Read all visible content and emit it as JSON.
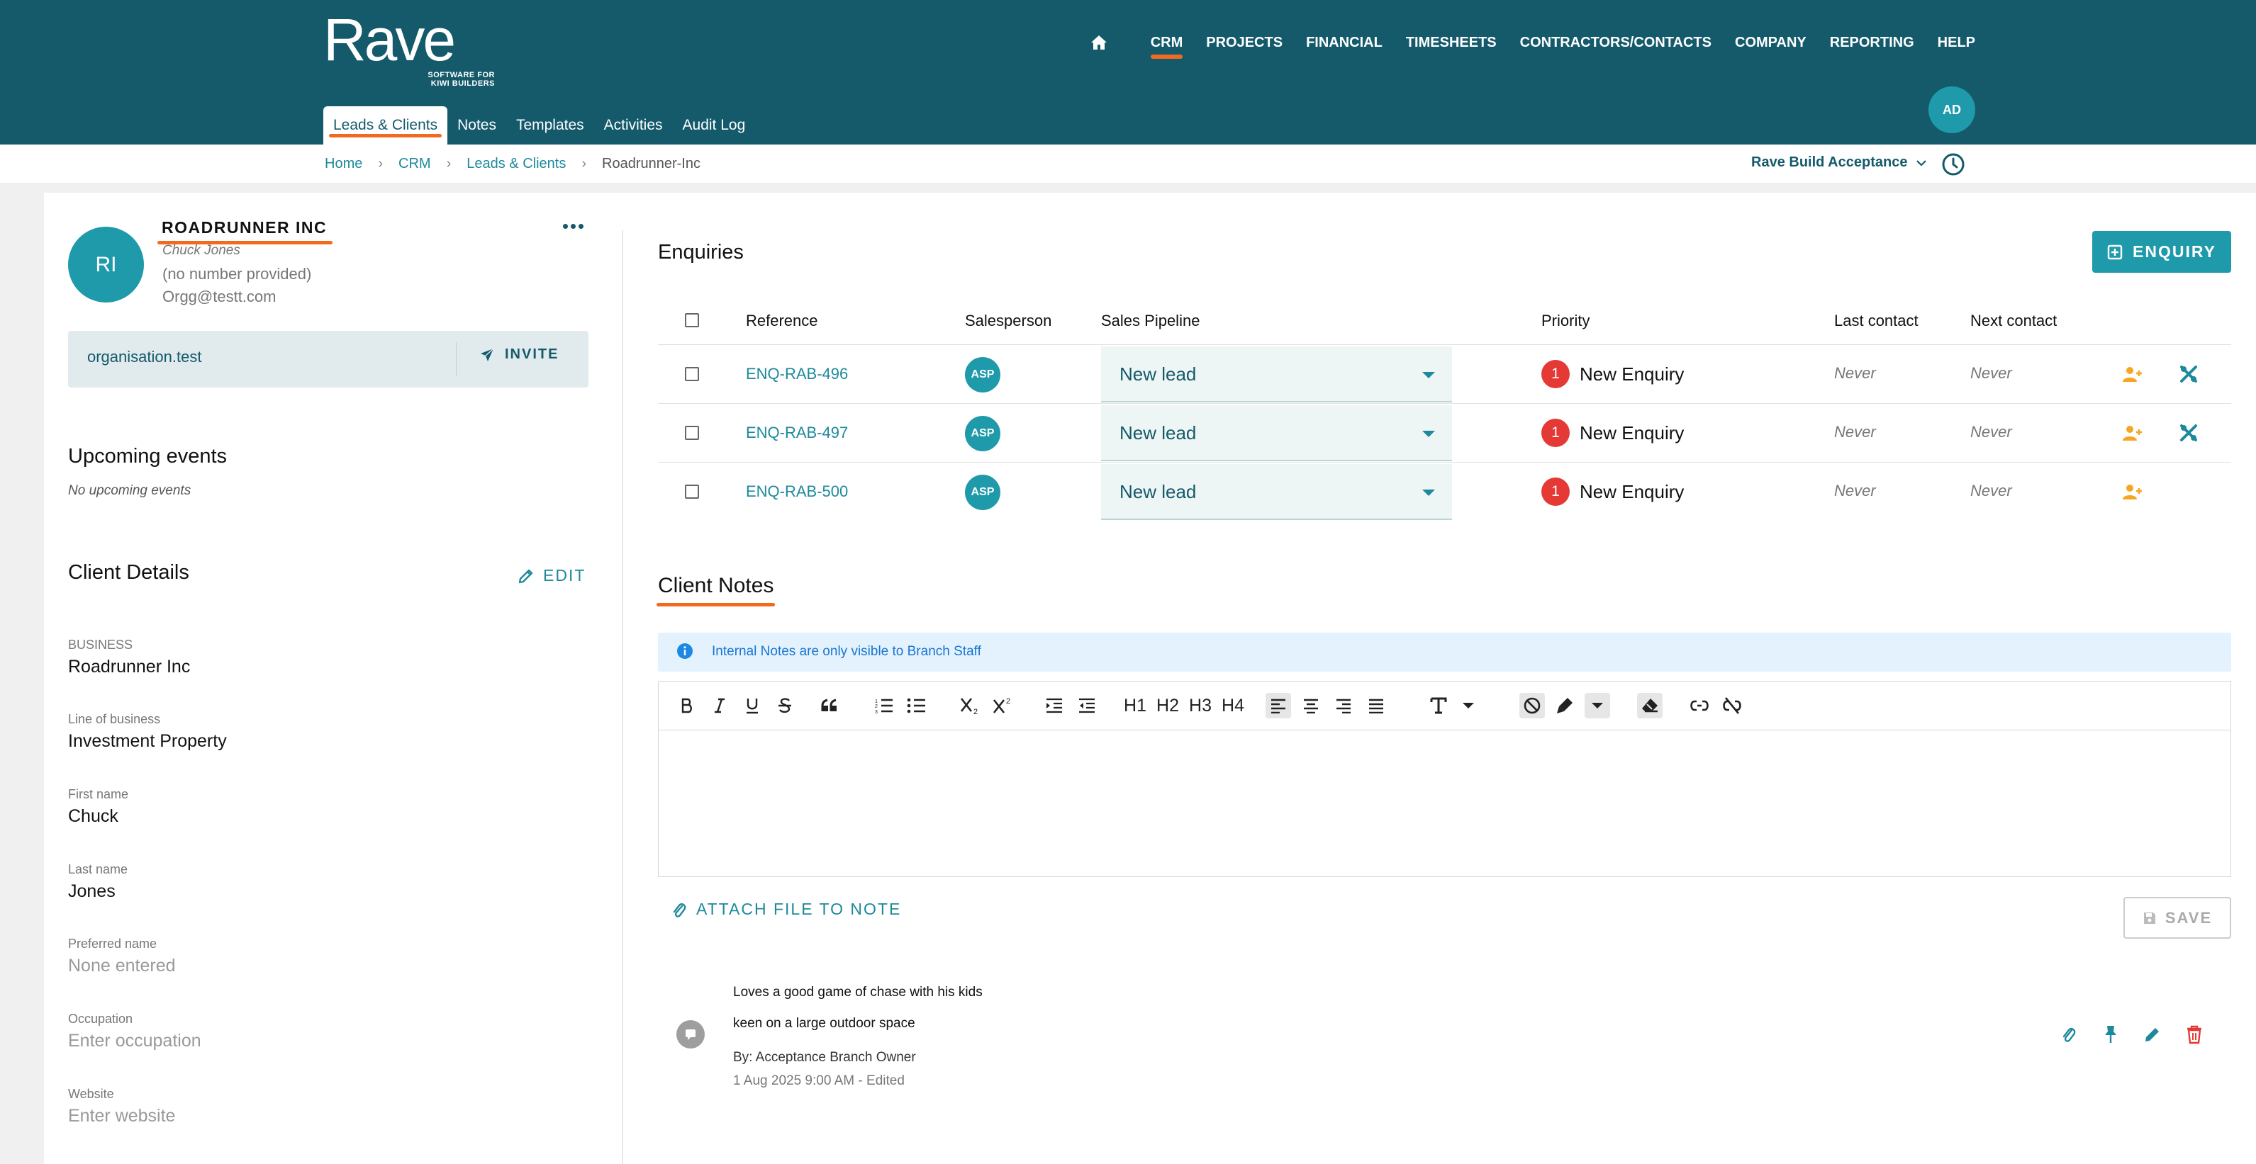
{
  "brand": {
    "name": "Rave",
    "tagline_line1": "SOFTWARE FOR",
    "tagline_line2": "KIWI BUILDERS"
  },
  "main_nav": [
    "CRM",
    "PROJECTS",
    "FINANCIAL",
    "TIMESHEETS",
    "CONTRACTORS/CONTACTS",
    "COMPANY",
    "REPORTING",
    "HELP"
  ],
  "user_initials": "AD",
  "sub_tabs": [
    "Leads & Clients",
    "Notes",
    "Templates",
    "Activities",
    "Audit Log"
  ],
  "breadcrumb": [
    "Home",
    "CRM",
    "Leads & Clients",
    "Roadrunner-Inc"
  ],
  "tenant_selector": "Rave Build Acceptance",
  "client": {
    "initials": "RI",
    "name": "ROADRUNNER INC",
    "contact": "Chuck Jones",
    "phone": "(no number provided)",
    "email": "Orgg@testt.com",
    "organisation": "organisation.test",
    "invite_label": "INVITE"
  },
  "upcoming": {
    "title": "Upcoming events",
    "empty": "No upcoming events"
  },
  "details": {
    "title": "Client Details",
    "edit_label": "EDIT",
    "fields": [
      {
        "label": "BUSINESS",
        "value": "Roadrunner Inc"
      },
      {
        "label": "Line of business",
        "value": "Investment Property"
      },
      {
        "label": "First name",
        "value": "Chuck"
      },
      {
        "label": "Last name",
        "value": "Jones"
      },
      {
        "label": "Preferred name",
        "value": "None entered"
      },
      {
        "label": "Occupation",
        "value": "Enter occupation"
      },
      {
        "label": "Website",
        "value": "Enter website"
      }
    ]
  },
  "enquiries": {
    "title": "Enquiries",
    "add_label": "ENQUIRY",
    "columns": [
      "Reference",
      "Salesperson",
      "Sales Pipeline",
      "Priority",
      "Last contact",
      "Next contact"
    ],
    "rows": [
      {
        "reference": "ENQ-RAB-496",
        "salesperson": "ASP",
        "pipeline": "New lead",
        "priority_num": "1",
        "priority": "New Enquiry",
        "last_contact": "Never",
        "next_contact": "Never"
      },
      {
        "reference": "ENQ-RAB-497",
        "salesperson": "ASP",
        "pipeline": "New lead",
        "priority_num": "1",
        "priority": "New Enquiry",
        "last_contact": "Never",
        "next_contact": "Never"
      },
      {
        "reference": "ENQ-RAB-500",
        "salesperson": "ASP",
        "pipeline": "New lead",
        "priority_num": "1",
        "priority": "New Enquiry",
        "last_contact": "Never",
        "next_contact": "Never"
      }
    ]
  },
  "notes": {
    "title": "Client Notes",
    "info": "Internal Notes are only visible to Branch Staff",
    "toolbar": {
      "h1": "H1",
      "h2": "H2",
      "h3": "H3",
      "h4": "H4"
    },
    "attach_label": "ATTACH FILE TO NOTE",
    "save_label": "SAVE",
    "items": [
      {
        "line1": "Loves a good game of chase with his kids",
        "line2": "keen on a large outdoor space",
        "by": "By: Acceptance Branch Owner",
        "date": "1 Aug 2025 9:00 AM - Edited"
      }
    ]
  },
  "colors": {
    "header": "#145a6b",
    "accent": "#1f9aaa",
    "highlight": "#f26a1f",
    "danger": "#e53935",
    "warn_icon": "#f5a623"
  }
}
